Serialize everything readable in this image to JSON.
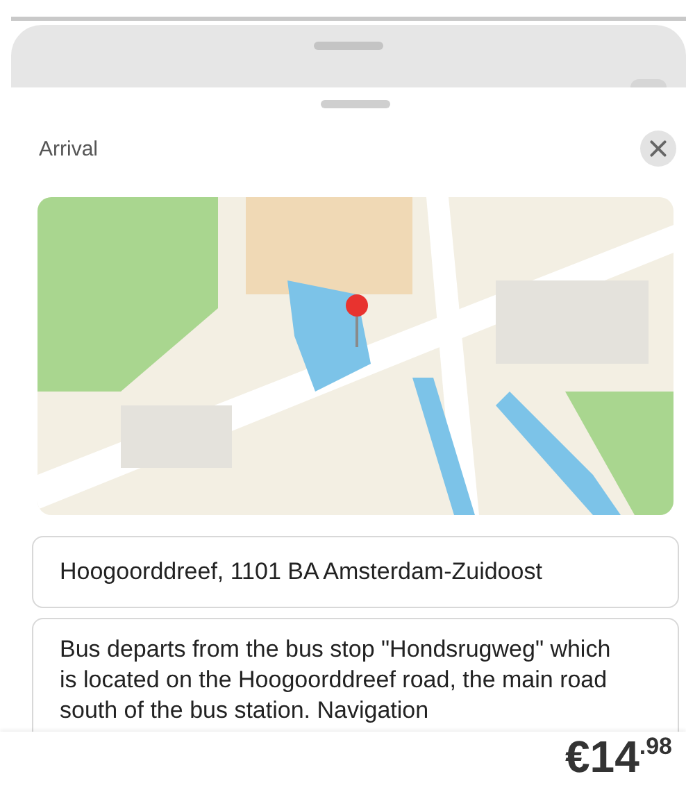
{
  "sheet": {
    "title": "Arrival"
  },
  "address": {
    "value": "Hoogoorddreef, 1101 BA Amsterdam-Zuidoost"
  },
  "description": {
    "value": "Bus departs from the bus stop \"Hondsrugweg\" which is located on the Hoogoorddreef road, the main road south of the bus station. Navigation"
  },
  "footer": {
    "price": "€14$^{.98}$"
  }
}
